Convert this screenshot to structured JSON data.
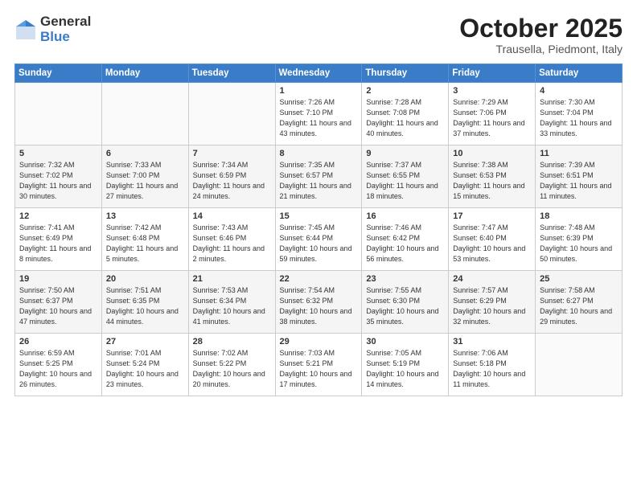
{
  "logo": {
    "general": "General",
    "blue": "Blue"
  },
  "header": {
    "month": "October 2025",
    "location": "Trausella, Piedmont, Italy"
  },
  "weekdays": [
    "Sunday",
    "Monday",
    "Tuesday",
    "Wednesday",
    "Thursday",
    "Friday",
    "Saturday"
  ],
  "weeks": [
    [
      {
        "day": "",
        "sunrise": "",
        "sunset": "",
        "daylight": ""
      },
      {
        "day": "",
        "sunrise": "",
        "sunset": "",
        "daylight": ""
      },
      {
        "day": "",
        "sunrise": "",
        "sunset": "",
        "daylight": ""
      },
      {
        "day": "1",
        "sunrise": "Sunrise: 7:26 AM",
        "sunset": "Sunset: 7:10 PM",
        "daylight": "Daylight: 11 hours and 43 minutes."
      },
      {
        "day": "2",
        "sunrise": "Sunrise: 7:28 AM",
        "sunset": "Sunset: 7:08 PM",
        "daylight": "Daylight: 11 hours and 40 minutes."
      },
      {
        "day": "3",
        "sunrise": "Sunrise: 7:29 AM",
        "sunset": "Sunset: 7:06 PM",
        "daylight": "Daylight: 11 hours and 37 minutes."
      },
      {
        "day": "4",
        "sunrise": "Sunrise: 7:30 AM",
        "sunset": "Sunset: 7:04 PM",
        "daylight": "Daylight: 11 hours and 33 minutes."
      }
    ],
    [
      {
        "day": "5",
        "sunrise": "Sunrise: 7:32 AM",
        "sunset": "Sunset: 7:02 PM",
        "daylight": "Daylight: 11 hours and 30 minutes."
      },
      {
        "day": "6",
        "sunrise": "Sunrise: 7:33 AM",
        "sunset": "Sunset: 7:00 PM",
        "daylight": "Daylight: 11 hours and 27 minutes."
      },
      {
        "day": "7",
        "sunrise": "Sunrise: 7:34 AM",
        "sunset": "Sunset: 6:59 PM",
        "daylight": "Daylight: 11 hours and 24 minutes."
      },
      {
        "day": "8",
        "sunrise": "Sunrise: 7:35 AM",
        "sunset": "Sunset: 6:57 PM",
        "daylight": "Daylight: 11 hours and 21 minutes."
      },
      {
        "day": "9",
        "sunrise": "Sunrise: 7:37 AM",
        "sunset": "Sunset: 6:55 PM",
        "daylight": "Daylight: 11 hours and 18 minutes."
      },
      {
        "day": "10",
        "sunrise": "Sunrise: 7:38 AM",
        "sunset": "Sunset: 6:53 PM",
        "daylight": "Daylight: 11 hours and 15 minutes."
      },
      {
        "day": "11",
        "sunrise": "Sunrise: 7:39 AM",
        "sunset": "Sunset: 6:51 PM",
        "daylight": "Daylight: 11 hours and 11 minutes."
      }
    ],
    [
      {
        "day": "12",
        "sunrise": "Sunrise: 7:41 AM",
        "sunset": "Sunset: 6:49 PM",
        "daylight": "Daylight: 11 hours and 8 minutes."
      },
      {
        "day": "13",
        "sunrise": "Sunrise: 7:42 AM",
        "sunset": "Sunset: 6:48 PM",
        "daylight": "Daylight: 11 hours and 5 minutes."
      },
      {
        "day": "14",
        "sunrise": "Sunrise: 7:43 AM",
        "sunset": "Sunset: 6:46 PM",
        "daylight": "Daylight: 11 hours and 2 minutes."
      },
      {
        "day": "15",
        "sunrise": "Sunrise: 7:45 AM",
        "sunset": "Sunset: 6:44 PM",
        "daylight": "Daylight: 10 hours and 59 minutes."
      },
      {
        "day": "16",
        "sunrise": "Sunrise: 7:46 AM",
        "sunset": "Sunset: 6:42 PM",
        "daylight": "Daylight: 10 hours and 56 minutes."
      },
      {
        "day": "17",
        "sunrise": "Sunrise: 7:47 AM",
        "sunset": "Sunset: 6:40 PM",
        "daylight": "Daylight: 10 hours and 53 minutes."
      },
      {
        "day": "18",
        "sunrise": "Sunrise: 7:48 AM",
        "sunset": "Sunset: 6:39 PM",
        "daylight": "Daylight: 10 hours and 50 minutes."
      }
    ],
    [
      {
        "day": "19",
        "sunrise": "Sunrise: 7:50 AM",
        "sunset": "Sunset: 6:37 PM",
        "daylight": "Daylight: 10 hours and 47 minutes."
      },
      {
        "day": "20",
        "sunrise": "Sunrise: 7:51 AM",
        "sunset": "Sunset: 6:35 PM",
        "daylight": "Daylight: 10 hours and 44 minutes."
      },
      {
        "day": "21",
        "sunrise": "Sunrise: 7:53 AM",
        "sunset": "Sunset: 6:34 PM",
        "daylight": "Daylight: 10 hours and 41 minutes."
      },
      {
        "day": "22",
        "sunrise": "Sunrise: 7:54 AM",
        "sunset": "Sunset: 6:32 PM",
        "daylight": "Daylight: 10 hours and 38 minutes."
      },
      {
        "day": "23",
        "sunrise": "Sunrise: 7:55 AM",
        "sunset": "Sunset: 6:30 PM",
        "daylight": "Daylight: 10 hours and 35 minutes."
      },
      {
        "day": "24",
        "sunrise": "Sunrise: 7:57 AM",
        "sunset": "Sunset: 6:29 PM",
        "daylight": "Daylight: 10 hours and 32 minutes."
      },
      {
        "day": "25",
        "sunrise": "Sunrise: 7:58 AM",
        "sunset": "Sunset: 6:27 PM",
        "daylight": "Daylight: 10 hours and 29 minutes."
      }
    ],
    [
      {
        "day": "26",
        "sunrise": "Sunrise: 6:59 AM",
        "sunset": "Sunset: 5:25 PM",
        "daylight": "Daylight: 10 hours and 26 minutes."
      },
      {
        "day": "27",
        "sunrise": "Sunrise: 7:01 AM",
        "sunset": "Sunset: 5:24 PM",
        "daylight": "Daylight: 10 hours and 23 minutes."
      },
      {
        "day": "28",
        "sunrise": "Sunrise: 7:02 AM",
        "sunset": "Sunset: 5:22 PM",
        "daylight": "Daylight: 10 hours and 20 minutes."
      },
      {
        "day": "29",
        "sunrise": "Sunrise: 7:03 AM",
        "sunset": "Sunset: 5:21 PM",
        "daylight": "Daylight: 10 hours and 17 minutes."
      },
      {
        "day": "30",
        "sunrise": "Sunrise: 7:05 AM",
        "sunset": "Sunset: 5:19 PM",
        "daylight": "Daylight: 10 hours and 14 minutes."
      },
      {
        "day": "31",
        "sunrise": "Sunrise: 7:06 AM",
        "sunset": "Sunset: 5:18 PM",
        "daylight": "Daylight: 10 hours and 11 minutes."
      },
      {
        "day": "",
        "sunrise": "",
        "sunset": "",
        "daylight": ""
      }
    ]
  ]
}
